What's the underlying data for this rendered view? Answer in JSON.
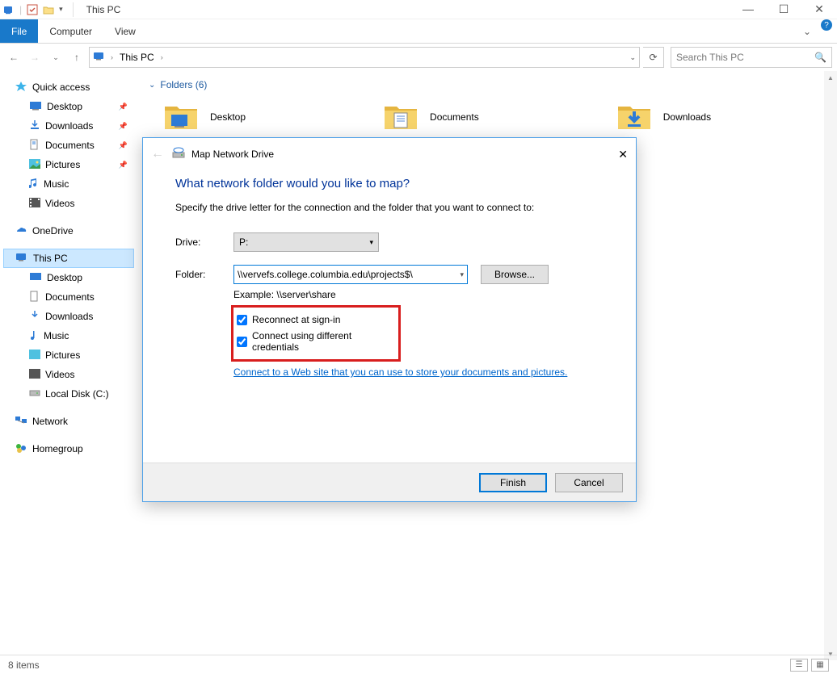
{
  "window": {
    "title": "This PC",
    "tabs": {
      "file": "File",
      "computer": "Computer",
      "view": "View"
    },
    "controls": {
      "min": "—",
      "max": "☐",
      "close": "✕"
    }
  },
  "address": {
    "location_icon": "monitor-icon",
    "crumbs": [
      "This PC"
    ],
    "refresh": "⟳",
    "expand": "⌄",
    "search_placeholder": "Search This PC"
  },
  "nav": {
    "quick": {
      "label": "Quick access",
      "items": [
        {
          "label": "Desktop",
          "icon": "desktop",
          "pinned": true
        },
        {
          "label": "Downloads",
          "icon": "download",
          "pinned": true
        },
        {
          "label": "Documents",
          "icon": "documents",
          "pinned": true
        },
        {
          "label": "Pictures",
          "icon": "pictures",
          "pinned": true
        },
        {
          "label": "Music",
          "icon": "music",
          "pinned": false
        },
        {
          "label": "Videos",
          "icon": "videos",
          "pinned": false
        }
      ]
    },
    "onedrive": {
      "label": "OneDrive"
    },
    "thispc": {
      "label": "This PC",
      "items": [
        {
          "label": "Desktop"
        },
        {
          "label": "Documents"
        },
        {
          "label": "Downloads"
        },
        {
          "label": "Music"
        },
        {
          "label": "Pictures"
        },
        {
          "label": "Videos"
        },
        {
          "label": "Local Disk (C:)"
        }
      ]
    },
    "network": {
      "label": "Network"
    },
    "homegroup": {
      "label": "Homegroup"
    }
  },
  "content": {
    "folders_header": "Folders (6)",
    "folders": [
      {
        "label": "Desktop",
        "type": "desktop"
      },
      {
        "label": "Documents",
        "type": "documents"
      },
      {
        "label": "Downloads",
        "type": "downloads"
      }
    ]
  },
  "statusbar": {
    "text": "8 items"
  },
  "dialog": {
    "title": "Map Network Drive",
    "heading": "What network folder would you like to map?",
    "sub": "Specify the drive letter for the connection and the folder that you want to connect to:",
    "drive_label": "Drive:",
    "drive_value": "P:",
    "folder_label": "Folder:",
    "folder_value": "\\\\vervefs.college.columbia.edu\\projects$\\",
    "browse": "Browse...",
    "example": "Example: \\\\server\\share",
    "chk_reconnect": "Reconnect at sign-in",
    "chk_credentials": "Connect using different credentials",
    "link_text": "Connect to a Web site that you can use to store your documents and pictures",
    "finish": "Finish",
    "cancel": "Cancel"
  }
}
